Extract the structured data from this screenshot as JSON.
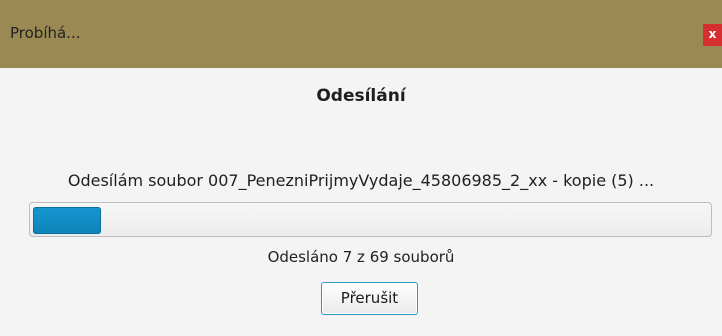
{
  "window": {
    "title": "Probíhá...",
    "close_label": "x"
  },
  "dialog": {
    "heading": "Odesílání",
    "message": "Odesílám soubor 007_PenezniPrijmyVydaje_45806985_2_xx - kopie (5) ...",
    "progress": {
      "value": 7,
      "max": 69,
      "fraction": 0.101
    },
    "status_text": "Odesláno 7 z 69 souborů",
    "abort_label": "Přerušit"
  },
  "colors": {
    "titlebar": "#9b8953",
    "close_button": "#d62f2f",
    "progress_fill": "#1597d2",
    "button_focus": "#2b98c7"
  }
}
